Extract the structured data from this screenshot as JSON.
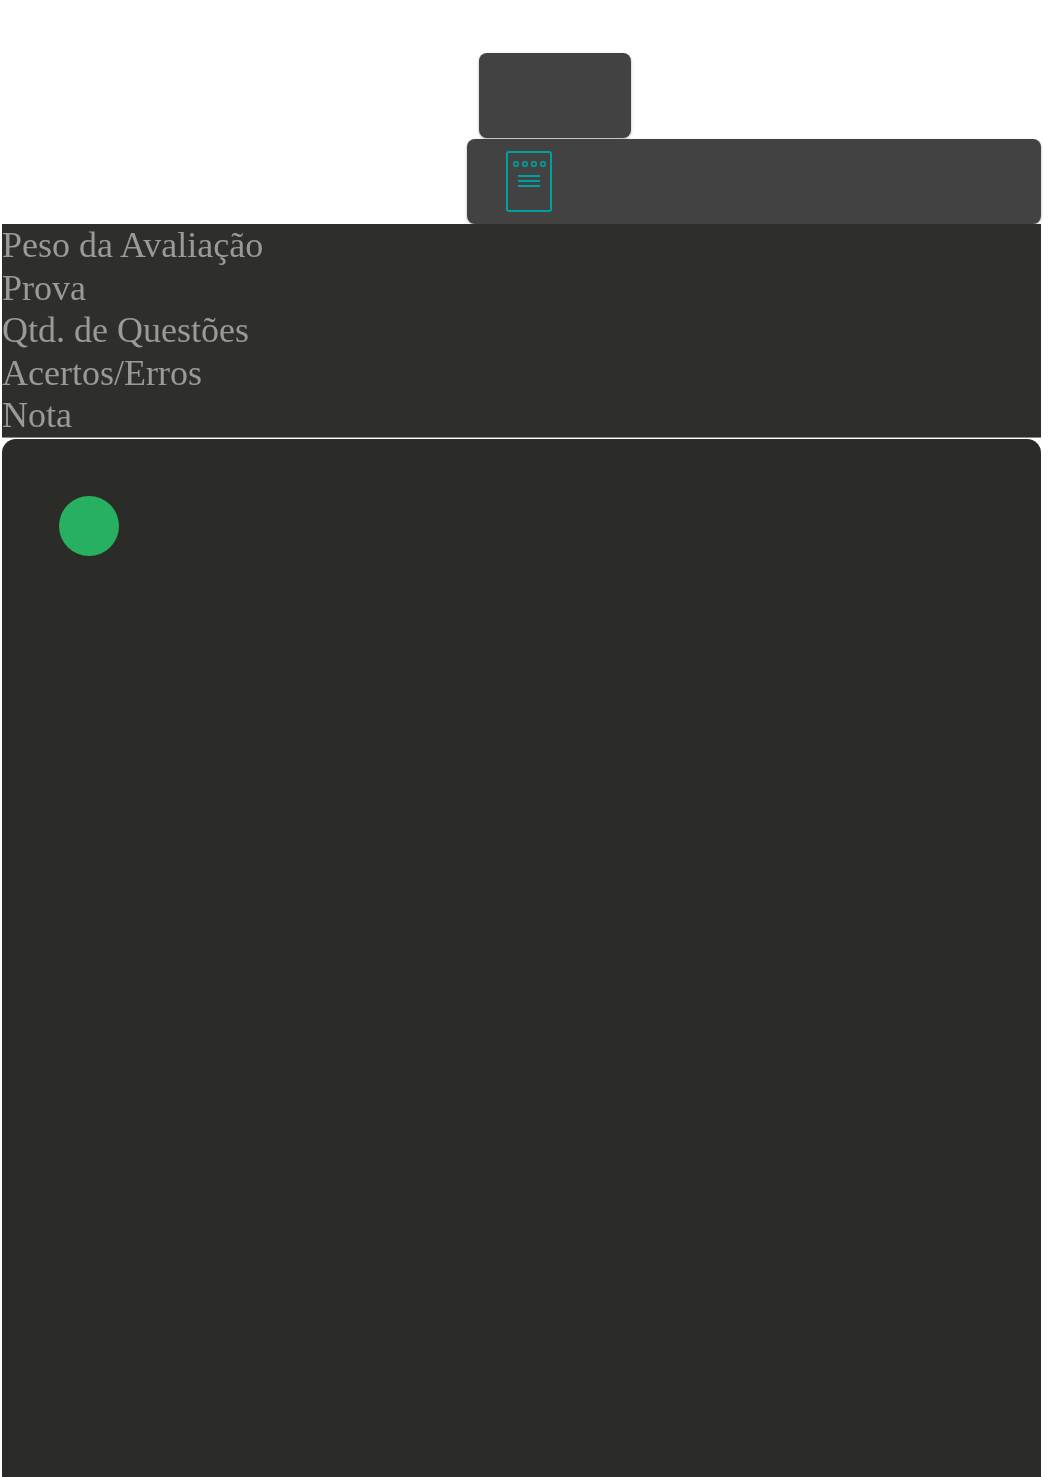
{
  "table_header": {
    "columns": [
      "Peso da Avaliação",
      "Prova",
      "Qtd. de Questões",
      "Acertos/Erros",
      "Nota"
    ]
  }
}
